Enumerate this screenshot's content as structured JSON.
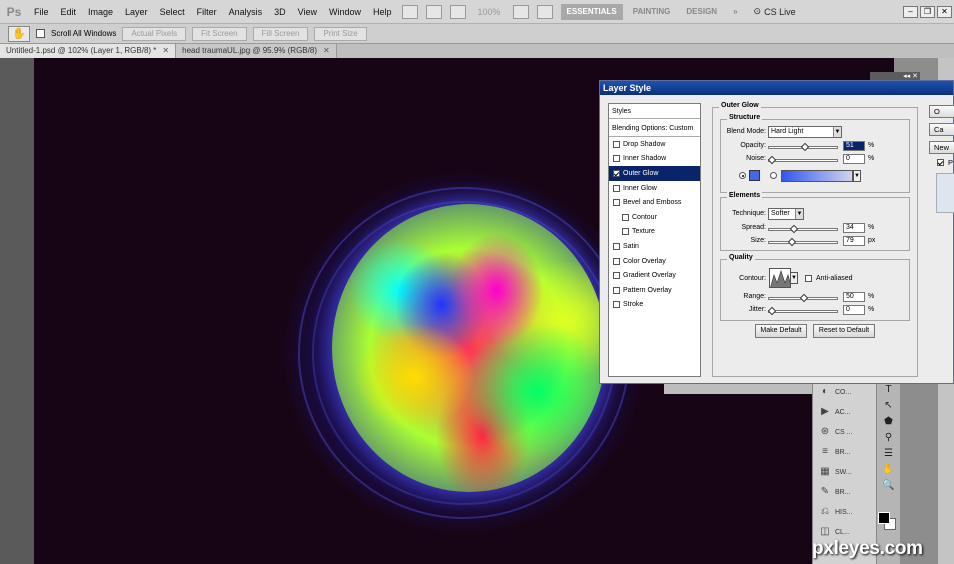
{
  "menubar": {
    "logo": "Ps",
    "items": [
      "File",
      "Edit",
      "Image",
      "Layer",
      "Select",
      "Filter",
      "Analysis",
      "3D",
      "View",
      "Window",
      "Help"
    ],
    "zoom": "100%",
    "workspaces": [
      "ESSENTIALS",
      "PAINTING",
      "DESIGN",
      "»"
    ],
    "cslive": "CS Live"
  },
  "optionsbar": {
    "scroll_all_label": "Scroll All Windows",
    "buttons": [
      "Actual Pixels",
      "Fit Screen",
      "Fill Screen",
      "Print Size"
    ]
  },
  "tabs": [
    {
      "label": "Untitled-1.psd @ 102% (Layer 1, RGB/8) *"
    },
    {
      "label": "head traumaUL.jpg @ 95.9% (RGB/8)"
    }
  ],
  "dialog": {
    "title": "Layer Style",
    "styles_header": "Styles",
    "blending_options": "Blending Options: Custom",
    "effects": [
      {
        "label": "Drop Shadow",
        "checked": false,
        "sub": false,
        "selected": false
      },
      {
        "label": "Inner Shadow",
        "checked": false,
        "sub": false,
        "selected": false
      },
      {
        "label": "Outer Glow",
        "checked": true,
        "sub": false,
        "selected": true
      },
      {
        "label": "Inner Glow",
        "checked": false,
        "sub": false,
        "selected": false
      },
      {
        "label": "Bevel and Emboss",
        "checked": false,
        "sub": false,
        "selected": false
      },
      {
        "label": "Contour",
        "checked": false,
        "sub": true,
        "selected": false
      },
      {
        "label": "Texture",
        "checked": false,
        "sub": true,
        "selected": false
      },
      {
        "label": "Satin",
        "checked": false,
        "sub": false,
        "selected": false
      },
      {
        "label": "Color Overlay",
        "checked": false,
        "sub": false,
        "selected": false
      },
      {
        "label": "Gradient Overlay",
        "checked": false,
        "sub": false,
        "selected": false
      },
      {
        "label": "Pattern Overlay",
        "checked": false,
        "sub": false,
        "selected": false
      },
      {
        "label": "Stroke",
        "checked": false,
        "sub": false,
        "selected": false
      }
    ],
    "section_title": "Outer Glow",
    "structure": {
      "title": "Structure",
      "blend_mode_label": "Blend Mode:",
      "blend_mode_value": "Hard Light",
      "opacity_label": "Opacity:",
      "opacity_value": "51",
      "noise_label": "Noise:",
      "noise_value": "0",
      "percent": "%",
      "glow_color": "#4466ee",
      "opacity_pct": 0.51,
      "noise_pct": 0.0
    },
    "elements": {
      "title": "Elements",
      "technique_label": "Technique:",
      "technique_value": "Softer",
      "spread_label": "Spread:",
      "spread_value": "34",
      "size_label": "Size:",
      "size_value": "79",
      "px": "px",
      "spread_pct": 0.34,
      "size_pct": 0.32
    },
    "quality": {
      "title": "Quality",
      "contour_label": "Contour:",
      "antialiased_label": "Anti-aliased",
      "range_label": "Range:",
      "range_value": "50",
      "jitter_label": "Jitter:",
      "jitter_value": "0",
      "range_pct": 0.5,
      "jitter_pct": 0.0
    },
    "make_default": "Make Default",
    "reset_default": "Reset to Default",
    "side_buttons": [
      "O",
      "Ca",
      "New"
    ],
    "preview_label": "P"
  },
  "panels": [
    {
      "label": "CO...",
      "icon": "color-icon"
    },
    {
      "label": "AC...",
      "icon": "actions-icon"
    },
    {
      "label": "CS ...",
      "icon": "clone-source-icon"
    },
    {
      "label": "BR...",
      "icon": "brush-icon"
    },
    {
      "label": "SW...",
      "icon": "swatches-icon"
    },
    {
      "label": "BR...",
      "icon": "brush-presets-icon"
    },
    {
      "label": "HIS...",
      "icon": "history-icon"
    },
    {
      "label": "CL...",
      "icon": "channels-icon"
    }
  ],
  "tools": [
    "T",
    "↖",
    "⬟",
    "⚲",
    "☰",
    "✋",
    "🔍"
  ],
  "watermark": "pxleyes.com"
}
